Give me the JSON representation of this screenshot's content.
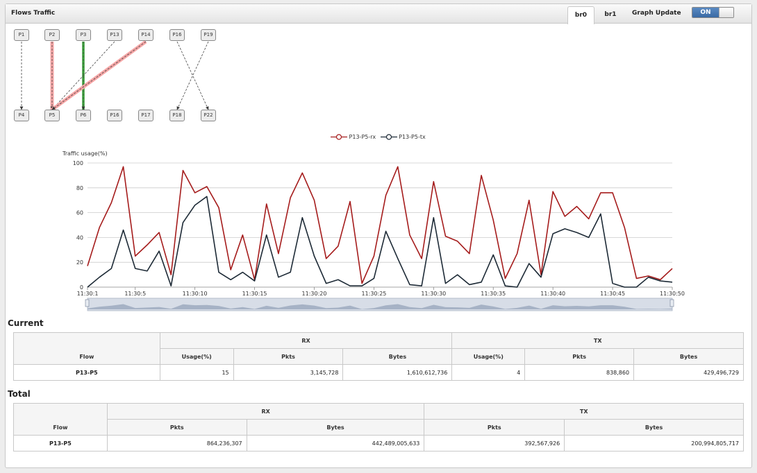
{
  "header": {
    "title": "Flows Traffic",
    "tabs": [
      {
        "label": "br0",
        "active": true
      },
      {
        "label": "br1",
        "active": false
      }
    ],
    "graph_update_label": "Graph Update",
    "toggle_label": "ON"
  },
  "topology": {
    "top_ports": [
      "P1",
      "P2",
      "P3",
      "P13",
      "P14",
      "P16",
      "P19"
    ],
    "bottom_ports": [
      "P4",
      "P5",
      "P6",
      "P16",
      "P17",
      "P18",
      "P22"
    ],
    "links": [
      {
        "from": "P1",
        "to": "P4",
        "style": "dashed"
      },
      {
        "from": "P2",
        "to": "P5",
        "style": "highlight-red"
      },
      {
        "from": "P3",
        "to": "P6",
        "style": "highlight-green"
      },
      {
        "from": "P13",
        "to": "P5",
        "style": "dashed"
      },
      {
        "from": "P14",
        "to": "P5",
        "style": "highlight-red"
      },
      {
        "from": "P16",
        "to": "P22",
        "style": "dashed"
      },
      {
        "from": "P19",
        "to": "P18",
        "style": "dashed"
      }
    ]
  },
  "colors": {
    "rx": "#a51c1c",
    "tx": "#1d2a36",
    "highlight_red": "#f5a5a5",
    "highlight_green": "#3aa43a",
    "toggle_on": "#4a7ab5"
  },
  "chart_data": {
    "type": "line",
    "ylabel": "Traffic usage(%)",
    "ylim": [
      0,
      100
    ],
    "yticks": [
      0,
      20,
      40,
      60,
      80,
      100
    ],
    "xlim": [
      1,
      50
    ],
    "xtick_values": [
      1,
      5,
      10,
      15,
      20,
      25,
      30,
      35,
      40,
      45,
      50
    ],
    "xtick_labels": [
      "11:30:1",
      "11:30:5",
      "11:30:10",
      "11:30:15",
      "11:30:20",
      "11:30:25",
      "11:30:30",
      "11:30:35",
      "11:30:40",
      "11:30:45",
      "11:30:50"
    ],
    "legend_position": "top-center",
    "grid": true,
    "x": [
      1,
      2,
      3,
      4,
      5,
      6,
      7,
      8,
      9,
      10,
      11,
      12,
      13,
      14,
      15,
      16,
      17,
      18,
      19,
      20,
      21,
      22,
      23,
      24,
      25,
      26,
      27,
      28,
      29,
      30,
      31,
      32,
      33,
      34,
      35,
      36,
      37,
      38,
      39,
      40,
      41,
      42,
      43,
      44,
      45,
      46,
      47,
      48,
      49,
      50
    ],
    "series": [
      {
        "name": "P13-P5-rx",
        "values": [
          17,
          48,
          68,
          97,
          25,
          34,
          44,
          10,
          94,
          76,
          81,
          64,
          14,
          42,
          6,
          67,
          27,
          72,
          92,
          70,
          23,
          33,
          69,
          3,
          25,
          74,
          97,
          42,
          23,
          85,
          41,
          37,
          27,
          90,
          54,
          7,
          27,
          70,
          10,
          77,
          57,
          65,
          55,
          76,
          76,
          48,
          7,
          9,
          6,
          15
        ]
      },
      {
        "name": "P13-P5-tx",
        "values": [
          0,
          8,
          15,
          46,
          15,
          13,
          29,
          1,
          52,
          66,
          73,
          12,
          6,
          12,
          5,
          42,
          8,
          12,
          56,
          25,
          3,
          6,
          1,
          1,
          7,
          45,
          23,
          2,
          1,
          56,
          3,
          10,
          2,
          4,
          26,
          1,
          0,
          19,
          8,
          43,
          47,
          44,
          40,
          59,
          3,
          0,
          0,
          8,
          5,
          4
        ]
      }
    ]
  },
  "current": {
    "title": "Current",
    "headers": {
      "flow": "Flow",
      "rx": "RX",
      "tx": "TX",
      "usage": "Usage(%)",
      "pkts": "Pkts",
      "bytes": "Bytes"
    },
    "row": {
      "flow": "P13-P5",
      "rx_usage": "15",
      "rx_pkts": "3,145,728",
      "rx_bytes": "1,610,612,736",
      "tx_usage": "4",
      "tx_pkts": "838,860",
      "tx_bytes": "429,496,729"
    }
  },
  "total": {
    "title": "Total",
    "headers": {
      "flow": "Flow",
      "rx": "RX",
      "tx": "TX",
      "pkts": "Pkts",
      "bytes": "Bytes"
    },
    "row": {
      "flow": "P13-P5",
      "rx_pkts": "864,236,307",
      "rx_bytes": "442,489,005,633",
      "tx_pkts": "392,567,926",
      "tx_bytes": "200,994,805,717"
    }
  }
}
